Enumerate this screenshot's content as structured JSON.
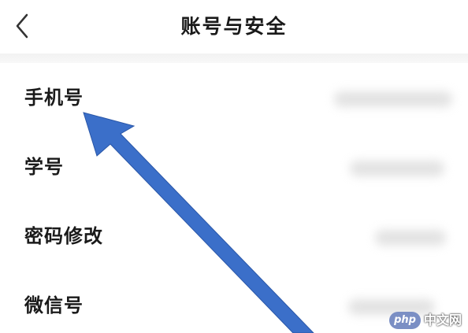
{
  "header": {
    "title": "账号与安全",
    "back_icon": "chevron-left-icon"
  },
  "list": {
    "items": [
      {
        "label": "手机号"
      },
      {
        "label": "学号"
      },
      {
        "label": "密码修改"
      },
      {
        "label": "微信号"
      }
    ]
  },
  "annotation": {
    "arrow_color": "#3b6fc9"
  },
  "watermark": {
    "logo": "php",
    "text": "中文网"
  }
}
